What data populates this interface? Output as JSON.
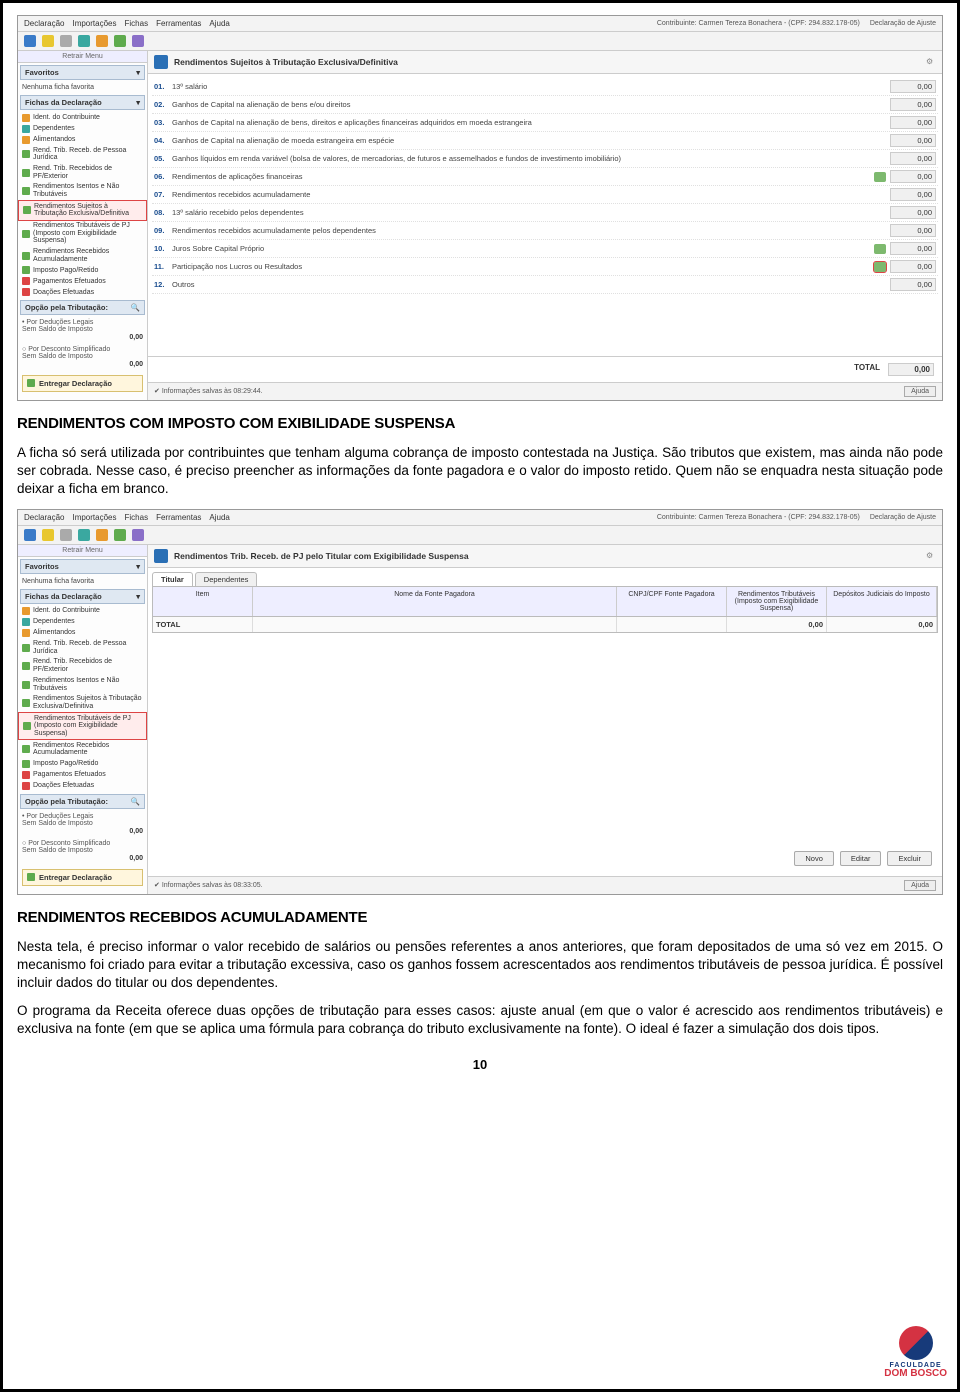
{
  "header": {
    "menus": [
      "Declaração",
      "Importações",
      "Fichas",
      "Ferramentas",
      "Ajuda"
    ],
    "contribuinte": "Contribuinte: Carmen Tereza Bonachera - (CPF: 294.832.178-05)",
    "decl_tipo": "Declaração de Ajuste"
  },
  "sidebar": {
    "retrair": "Retrair Menu",
    "favoritos": "Favoritos",
    "nenhuma": "Nenhuma ficha favorita",
    "fichas_head": "Fichas da Declaração",
    "items": [
      {
        "label": "Ident. do Contribuinte",
        "iconClass": "ic-orange"
      },
      {
        "label": "Dependentes",
        "iconClass": "ic-teal"
      },
      {
        "label": "Alimentandos",
        "iconClass": "ic-orange"
      },
      {
        "label": "Rend. Trib. Receb. de Pessoa Jurídica",
        "iconClass": "ic-green"
      },
      {
        "label": "Rend. Trib. Recebidos de PF/Exterior",
        "iconClass": "ic-green"
      },
      {
        "label": "Rendimentos Isentos e Não Tributáveis",
        "iconClass": "ic-green"
      },
      {
        "label": "Rendimentos Sujeitos à Tributação Exclusiva/Definitiva",
        "iconClass": "ic-green"
      },
      {
        "label": "Rendimentos Tributáveis de PJ (Imposto com Exigibilidade Suspensa)",
        "iconClass": "ic-green"
      },
      {
        "label": "Rendimentos Recebidos Acumuladamente",
        "iconClass": "ic-green"
      },
      {
        "label": "Imposto Pago/Retido",
        "iconClass": "ic-green"
      },
      {
        "label": "Pagamentos Efetuados",
        "iconClass": "ic-red"
      },
      {
        "label": "Doações Efetuadas",
        "iconClass": "ic-red"
      }
    ],
    "selected_a": 6,
    "selected_b": 7,
    "opcao_head": "Opção pela Tributação:",
    "tax_options": [
      {
        "label": "Por Deduções Legais",
        "sub": "Sem Saldo de Imposto",
        "val": "0,00"
      },
      {
        "label": "Por Desconto Simplificado",
        "sub": "Sem Saldo de Imposto",
        "val": "0,00"
      }
    ],
    "entregar": "Entregar Declaração"
  },
  "panel1": {
    "title": "Rendimentos Sujeitos à Tributação Exclusiva/Definitiva",
    "rows": [
      {
        "num": "01.",
        "label": "13º salário",
        "val": "0,00",
        "icon": false
      },
      {
        "num": "02.",
        "label": "Ganhos de Capital na alienação de bens e/ou direitos",
        "val": "0,00",
        "icon": false
      },
      {
        "num": "03.",
        "label": "Ganhos de Capital na alienação de bens, direitos e aplicações financeiras adquiridos em moeda estrangeira",
        "val": "0,00",
        "icon": false
      },
      {
        "num": "04.",
        "label": "Ganhos de Capital na alienação de moeda estrangeira em espécie",
        "val": "0,00",
        "icon": false
      },
      {
        "num": "05.",
        "label": "Ganhos líquidos em renda variável (bolsa de valores, de mercadorias, de futuros e assemelhados e fundos de investimento imobiliário)",
        "val": "0,00",
        "icon": false
      },
      {
        "num": "06.",
        "label": "Rendimentos de aplicações financeiras",
        "val": "0,00",
        "icon": true
      },
      {
        "num": "07.",
        "label": "Rendimentos recebidos acumuladamente",
        "val": "0,00",
        "icon": false
      },
      {
        "num": "08.",
        "label": "13º salário recebido pelos dependentes",
        "val": "0,00",
        "icon": false
      },
      {
        "num": "09.",
        "label": "Rendimentos recebidos acumuladamente pelos dependentes",
        "val": "0,00",
        "icon": false
      },
      {
        "num": "10.",
        "label": "Juros Sobre Capital Próprio",
        "val": "0,00",
        "icon": true
      },
      {
        "num": "11.",
        "label": "Participação nos Lucros ou Resultados",
        "val": "0,00",
        "icon": true,
        "hl": true
      },
      {
        "num": "12.",
        "label": "Outros",
        "val": "0,00",
        "icon": false
      }
    ],
    "total_label": "TOTAL",
    "total_value": "0,00",
    "status": "Informações salvas às 08:29:44.",
    "ajuda": "Ajuda"
  },
  "section1": {
    "heading": "RENDIMENTOS COM IMPOSTO COM EXIBILIDADE SUSPENSA",
    "para": "A ficha só será utilizada por contribuintes que tenham alguma cobrança de imposto contestada na Justiça. São tributos que existem, mas ainda não pode ser cobrada. Nesse caso, é preciso preencher as informações da fonte pagadora e o valor do imposto retido. Quem não se enquadra nesta situação pode deixar a ficha em branco."
  },
  "panel2": {
    "title": "Rendimentos Trib. Receb. de PJ pelo Titular com Exigibilidade Suspensa",
    "tabs": [
      "Titular",
      "Dependentes"
    ],
    "columns": [
      "Item",
      "Nome da Fonte Pagadora",
      "CNPJ/CPF Fonte Pagadora",
      "Rendimentos Tributáveis (Imposto com Exigibilidade Suspensa)",
      "Depósitos Judiciais do Imposto"
    ],
    "total_label": "TOTAL",
    "total_v1": "0,00",
    "total_v2": "0,00",
    "buttons": [
      "Novo",
      "Editar",
      "Excluir"
    ],
    "status": "Informações salvas às 08:33:05.",
    "ajuda": "Ajuda"
  },
  "section2": {
    "heading": "RENDIMENTOS RECEBIDOS ACUMULADAMENTE",
    "para1": "Nesta tela, é preciso informar o valor recebido de salários ou pensões referentes a anos anteriores, que foram depositados de uma só vez em 2015. O mecanismo foi criado para evitar a tributação excessiva, caso os ganhos fossem acrescentados aos rendimentos tributáveis de pessoa jurídica. É possível incluir dados do titular ou dos dependentes.",
    "para2": "O programa da Receita oferece duas opções de tributação para esses casos: ajuste anual (em que o valor é acrescido aos rendimentos tributáveis) e exclusiva na fonte (em que se aplica uma fórmula para cobrança do tributo exclusivamente na fonte). O ideal é fazer a simulação dos dois tipos."
  },
  "page_number": "10",
  "logo": {
    "line1": "FACULDADE",
    "line2": "DOM BOSCO"
  }
}
